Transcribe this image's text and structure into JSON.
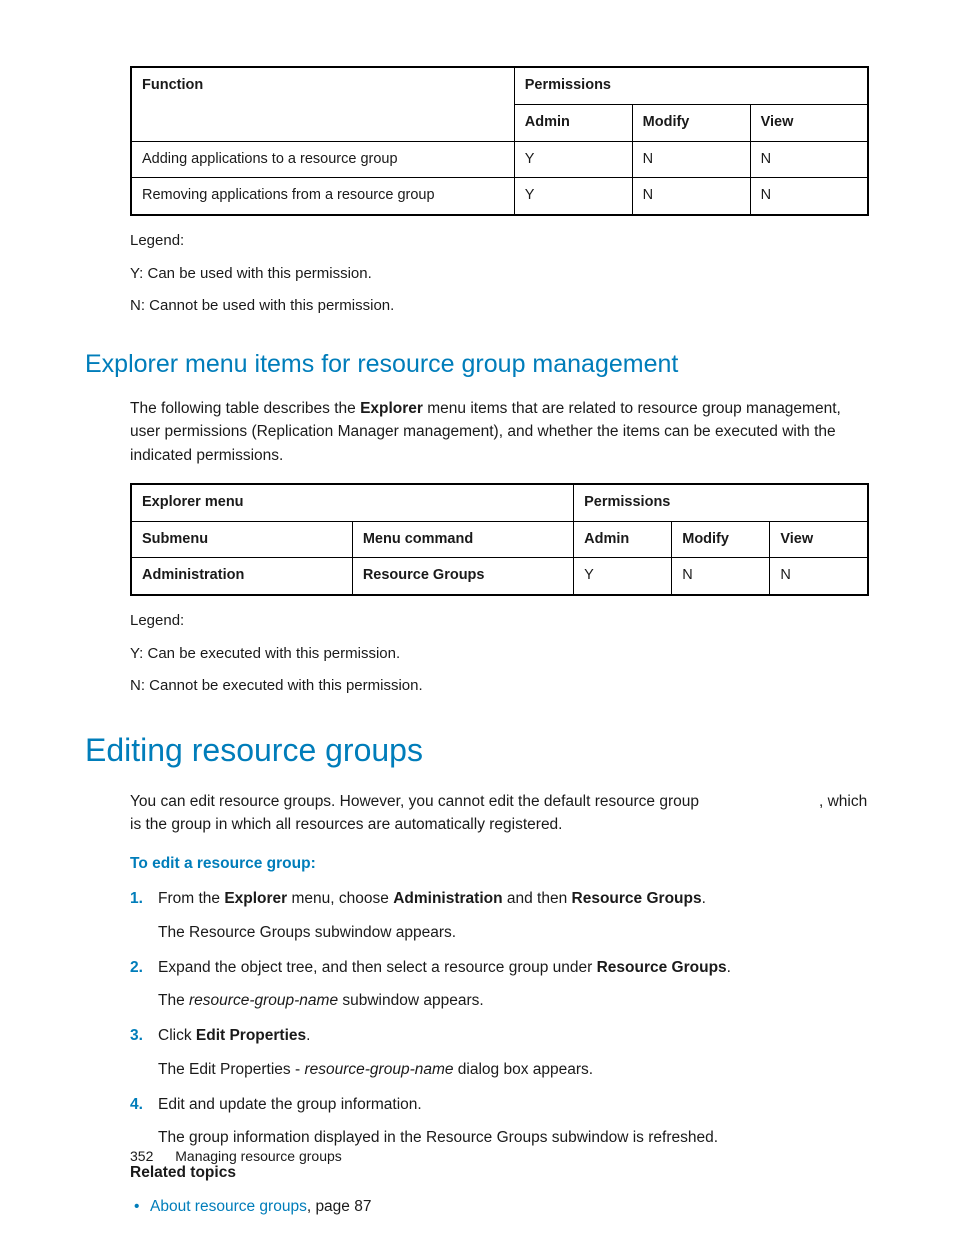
{
  "table1": {
    "headers": {
      "function": "Function",
      "permissions": "Permissions",
      "admin": "Admin",
      "modify": "Modify",
      "view": "View"
    },
    "rows": [
      {
        "fn": "Adding applications to a resource group",
        "admin": "Y",
        "modify": "N",
        "view": "N"
      },
      {
        "fn": "Removing applications from a resource group",
        "admin": "Y",
        "modify": "N",
        "view": "N"
      }
    ]
  },
  "legend1": {
    "title": "Legend:",
    "y": "Y: Can be used with this permission.",
    "n": "N: Cannot be used with this permission."
  },
  "section1": {
    "heading": "Explorer menu items for resource group management",
    "intro_pre": "The following table describes the ",
    "intro_bold": "Explorer",
    "intro_post": " menu items that are related to resource group management, user permissions (Replication Manager management), and whether the items can be executed with the indicated permissions."
  },
  "table2": {
    "headers": {
      "explorer": "Explorer menu",
      "permissions": "Permissions",
      "submenu": "Submenu",
      "command": "Menu command",
      "admin": "Admin",
      "modify": "Modify",
      "view": "View"
    },
    "rows": [
      {
        "submenu": "Administration",
        "command": "Resource Groups",
        "admin": "Y",
        "modify": "N",
        "view": "N"
      }
    ]
  },
  "legend2": {
    "title": "Legend:",
    "y": "Y: Can be executed with this permission.",
    "n": "N: Cannot be executed with this permission."
  },
  "section2": {
    "heading": "Editing resource groups",
    "intro": "You can edit resource groups. However, you cannot edit the default resource group",
    "intro_tail": ", which is the group in which all resources are automatically registered.",
    "proc_title": "To edit a resource group:",
    "steps": [
      {
        "n": "1.",
        "t1": "From the ",
        "b1": "Explorer",
        "t2": " menu, choose ",
        "b2": "Administration",
        "t3": " and then ",
        "b3": "Resource Groups",
        "t4": ".",
        "sub": "The Resource Groups subwindow appears."
      },
      {
        "n": "2.",
        "t1": "Expand the object tree, and then select a resource group under ",
        "b1": "Resource Groups",
        "t2": ".",
        "sub_pre": "The ",
        "sub_it": "resource-group-name",
        "sub_post": " subwindow appears."
      },
      {
        "n": "3.",
        "t1": "Click ",
        "b1": "Edit Properties",
        "t2": ".",
        "sub_pre": "The Edit Properties - ",
        "sub_it": "resource-group-name",
        "sub_post": " dialog box appears."
      },
      {
        "n": "4.",
        "t1": "Edit and update the group information.",
        "sub": "The group information displayed in the Resource Groups subwindow is refreshed."
      }
    ],
    "related_title": "Related topics",
    "related_link": "About resource groups",
    "related_tail": ", page 87"
  },
  "footer": {
    "page": "352",
    "chapter": "Managing resource groups"
  }
}
